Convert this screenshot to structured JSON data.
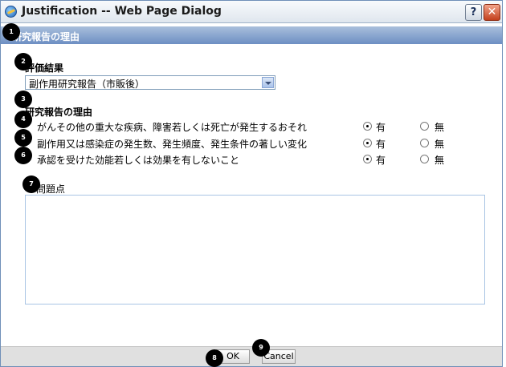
{
  "window": {
    "title": "Justification -- Web Page Dialog",
    "help_label": "?",
    "close_label": "✕"
  },
  "header": {
    "title": "研究報告の理由"
  },
  "evaluation": {
    "label": "評価結果",
    "selected": "副作用研究報告（市販後）"
  },
  "reasons": {
    "label": "研究報告の理由",
    "items": [
      {
        "text": "がんその他の重大な疾病、障害若しくは死亡が発生するおそれ",
        "yes": "有",
        "no": "無",
        "selected": "yes"
      },
      {
        "text": "副作用又は感染症の発生数、発生頻度、発生条件の著しい変化",
        "yes": "有",
        "no": "無",
        "selected": "yes"
      },
      {
        "text": "承認を受けた効能若しくは効果を有しないこと",
        "yes": "有",
        "no": "無",
        "selected": "yes"
      }
    ]
  },
  "issues": {
    "label": "問題点",
    "value": ""
  },
  "footer": {
    "ok_label": "OK",
    "cancel_label": "Cancel"
  },
  "badges": [
    "1",
    "2",
    "3",
    "4",
    "5",
    "6",
    "7",
    "8",
    "9"
  ]
}
